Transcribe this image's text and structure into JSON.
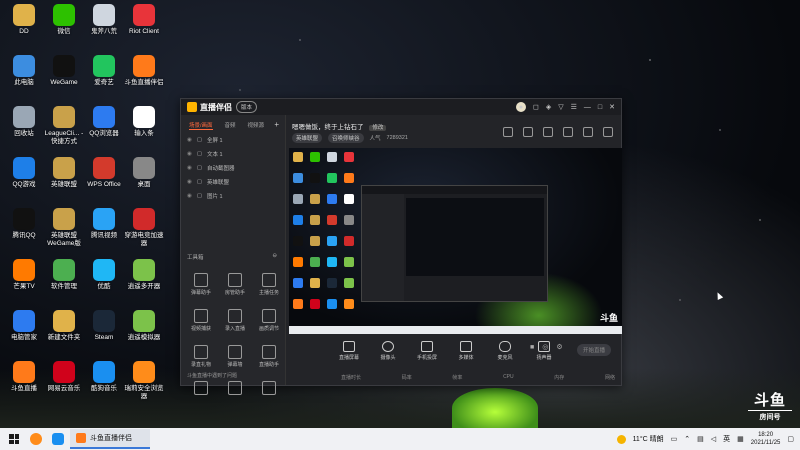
{
  "desktop_icons": [
    {
      "label": "DD",
      "icon": "folder-icon",
      "color": "#e0b24a"
    },
    {
      "label": "微信",
      "icon": "wechat-icon",
      "color": "#2dc100"
    },
    {
      "label": "鬼斧八荒",
      "icon": "game-icon",
      "color": "#cfd6df"
    },
    {
      "label": "Riot Client",
      "icon": "riot-icon",
      "color": "#e8343a"
    },
    {
      "label": "此电脑",
      "icon": "computer-icon",
      "color": "#3c8de0"
    },
    {
      "label": "WeGame",
      "icon": "wegame-icon",
      "color": "#111111"
    },
    {
      "label": "爱奇艺",
      "icon": "iqiyi-icon",
      "color": "#22c55e"
    },
    {
      "label": "斗鱼直播伴侣",
      "icon": "douyu-icon",
      "color": "#ff7a1a"
    },
    {
      "label": "回收站",
      "icon": "recycle-bin-icon",
      "color": "#9aa7b5"
    },
    {
      "label": "LeagueCli... - 快捷方式",
      "icon": "league-icon",
      "color": "#c9a14a"
    },
    {
      "label": "QQ浏览器",
      "icon": "qq-browser-icon",
      "color": "#2d7bf0"
    },
    {
      "label": "输入条",
      "icon": "document-icon",
      "color": "#ffffff"
    },
    {
      "label": "QQ游戏",
      "icon": "qq-game-icon",
      "color": "#1e7fe8"
    },
    {
      "label": "英雄联盟",
      "icon": "lol-icon",
      "color": "#c9a14a"
    },
    {
      "label": "WPS Office",
      "icon": "wps-icon",
      "color": "#d33a2c"
    },
    {
      "label": "桌面",
      "icon": "desktop-icon",
      "color": "#888888"
    },
    {
      "label": "腾讯QQ",
      "icon": "qq-icon",
      "color": "#111111"
    },
    {
      "label": "英雄联盟 WeGame版",
      "icon": "lol-icon",
      "color": "#c9a14a"
    },
    {
      "label": "腾讯视频",
      "icon": "tencent-video-icon",
      "color": "#2aa3f5"
    },
    {
      "label": "穿游电竞加速器",
      "icon": "accelerator-icon",
      "color": "#d12a2a"
    },
    {
      "label": "芒果TV",
      "icon": "mango-tv-icon",
      "color": "#ff7a00"
    },
    {
      "label": "软件管理",
      "icon": "software-manager-icon",
      "color": "#4caf50"
    },
    {
      "label": "优酷",
      "icon": "youku-icon",
      "color": "#1fb7f5"
    },
    {
      "label": "逍遥多开器",
      "icon": "multi-open-icon",
      "color": "#7cc24a"
    },
    {
      "label": "电脑管家",
      "icon": "pc-manager-icon",
      "color": "#2d7bf0"
    },
    {
      "label": "新建文件夹",
      "icon": "folder-icon",
      "color": "#e0b24a"
    },
    {
      "label": "Steam",
      "icon": "steam-icon",
      "color": "#1b2838"
    },
    {
      "label": "逍遥模拟器",
      "icon": "emulator-icon",
      "color": "#7cc24a"
    },
    {
      "label": "斗鱼直播",
      "icon": "douyu-icon",
      "color": "#ff7a1a"
    },
    {
      "label": "网易云音乐",
      "icon": "netease-music-icon",
      "color": "#d0021b"
    },
    {
      "label": "酷狗音乐",
      "icon": "kugou-icon",
      "color": "#1a8ff0"
    },
    {
      "label": "瑞莉安全浏览器",
      "icon": "browser-icon",
      "color": "#ff8c1a"
    }
  ],
  "app": {
    "title": "直播伴侣",
    "version_badge": "版本",
    "side_tabs": [
      "场景/画面",
      "音频",
      "视频源"
    ],
    "sources": [
      "全屏 1",
      "文本 1",
      "自动截图器",
      "英雄联盟",
      "图片 1"
    ],
    "tools_title": "工具箱",
    "tools": [
      "弹幕助手",
      "房管助手",
      "主播任务",
      "视频捕获",
      "录入直播",
      "画质调节",
      "录直礼物",
      "弹幕墙",
      "直播助手",
      "",
      "",
      ""
    ],
    "side_footer": "斗鱼直播中遇到了问题",
    "stream_title": "嗯嗯做饭，终于上钻石了",
    "edit_label": "修改",
    "sub_info": [
      "英雄联盟",
      "召唤师峡谷",
      "人气",
      "7289321"
    ],
    "controls": [
      "直播屏幕",
      "摄像头",
      "手机投屏",
      "多媒体",
      "麦克风",
      "扬声器"
    ],
    "start_button": "开始直播",
    "status": [
      "直播时长",
      "码率",
      "帧率",
      "CPU",
      "内存",
      "网络"
    ]
  },
  "taskbar": {
    "app_label": "斗鱼直播伴侣",
    "weather": "11°C 晴朗",
    "ime": "英",
    "time": "18:20",
    "date": "2021/11/25"
  },
  "watermark": {
    "line1": "斗鱼",
    "line2": "房间号"
  }
}
